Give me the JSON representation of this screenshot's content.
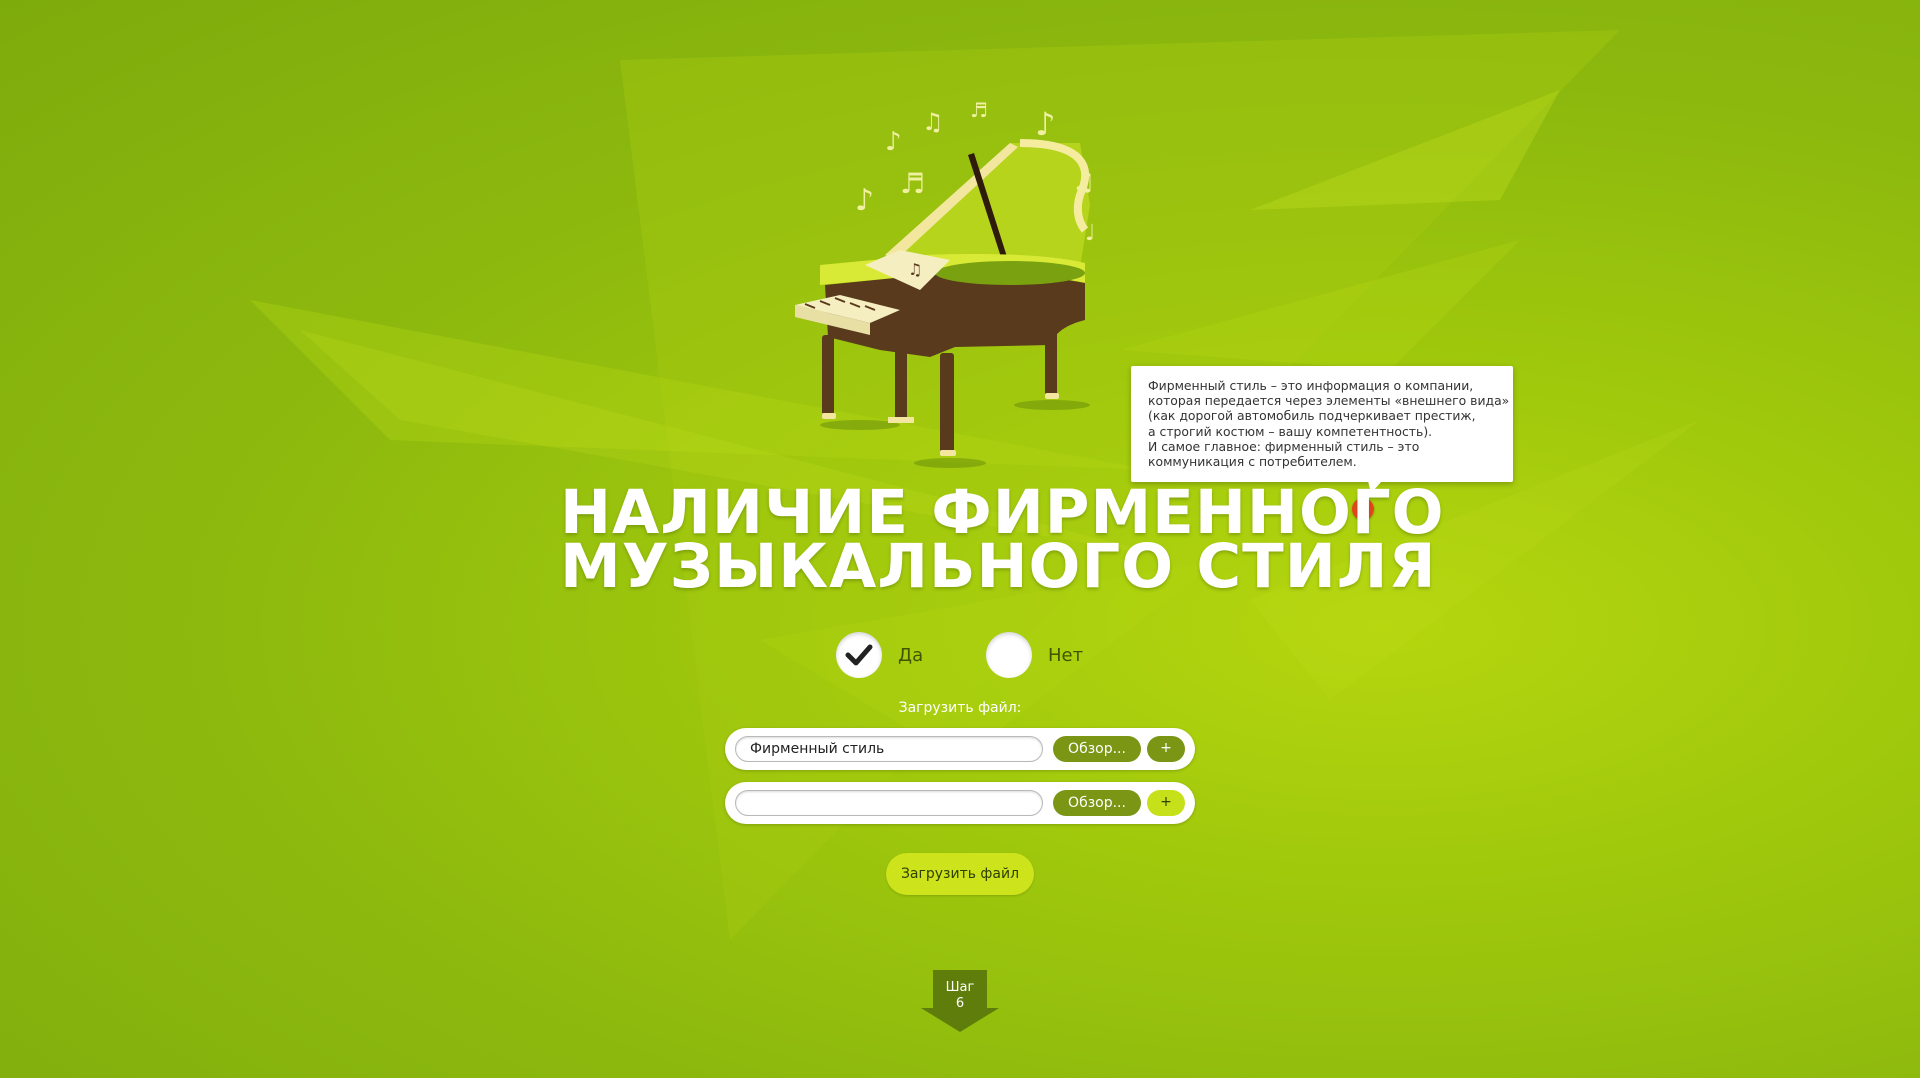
{
  "tooltip": {
    "lines": [
      "Фирменный стиль – это информация о компании,",
      "которая передается через элементы «внешнего вида»",
      "(как дорогой автомобиль подчеркивает престиж,",
      "а строгий костюм – вашу компетентность).",
      "И самое главное: фирменный стиль – это",
      "коммуникация с потребителем."
    ],
    "help_symbol": "?"
  },
  "heading": {
    "line1": "НАЛИЧИЕ ФИРМЕННОГО",
    "line2": "МУЗЫКАЛЬНОГО СТИЛЯ"
  },
  "options": {
    "yes_label": "Да",
    "no_label": "Нет",
    "selected": "yes"
  },
  "upload": {
    "title": "Загрузить файл:",
    "rows": [
      {
        "value": "Фирменный стиль",
        "browse_label": "Обзор...",
        "add_label": "+"
      },
      {
        "value": "",
        "browse_label": "Обзор...",
        "add_label": "+"
      }
    ],
    "submit_label": "Загрузить файл"
  },
  "step": {
    "label": "Шаг",
    "number": "6"
  },
  "colors": {
    "accent_dark": "#7a9614",
    "accent_light": "#cde31c",
    "help_red": "#e2481b"
  },
  "icons": {
    "illustration": "grand-piano-with-music-notes",
    "check": "checkmark-icon",
    "help": "question-icon",
    "step": "down-arrow-icon"
  }
}
